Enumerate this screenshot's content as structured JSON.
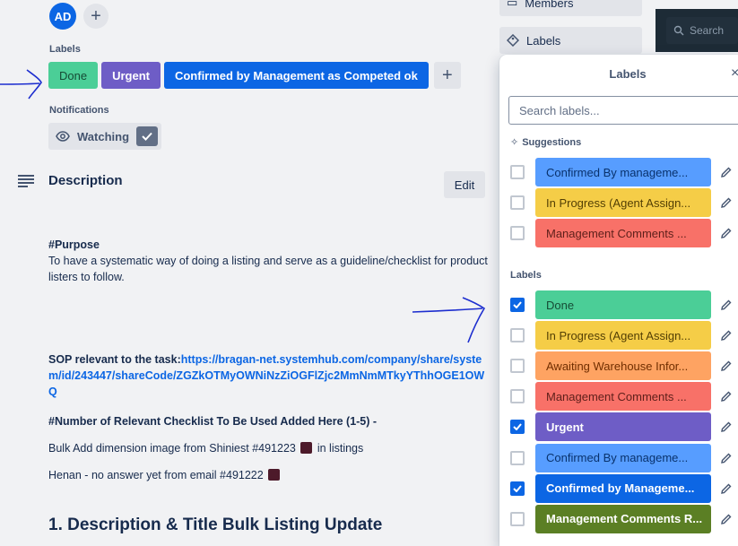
{
  "card": {
    "avatar_initials": "AD",
    "labels_heading": "Labels",
    "notifications_heading": "Notifications",
    "watching_label": "Watching",
    "applied_labels": [
      {
        "text": "Done",
        "color": "#4bce97"
      },
      {
        "text": "Urgent",
        "color": "#6e5dc6"
      },
      {
        "text": "Confirmed by Management as Competed ok",
        "color": "#0c66e4"
      }
    ],
    "description_title": "Description",
    "edit_label": "Edit",
    "purpose_heading": "#Purpose",
    "purpose_text": "To have a systematic way of doing a listing and serve as a guideline/checklist for product listers to follow.",
    "sop_label": "SOP relevant to the task:",
    "sop_link": "https://bragan-net.systemhub.com/company/share/system/id/243447/shareCode/ZGZkOTMyOWNiNzZiOGFlZjc2MmNmMTkyYThhOGE1OWQ",
    "checklist_heading": "#Number of Relevant Checklist To Be Used Added Here (1-5) -",
    "checklist_items": [
      {
        "text": "Bulk Add dimension image from Shiniest #491223",
        "suffix": "in listings"
      },
      {
        "text": "Henan - no answer yet from email #491222",
        "suffix": ""
      }
    ],
    "section_heading": "1. Description & Title Bulk Listing Update"
  },
  "sidebar": {
    "members_label": "Members",
    "labels_label": "Labels",
    "search_placeholder": "Search"
  },
  "popover": {
    "title": "Labels",
    "close_glyph": "×",
    "search_placeholder": "Search labels...",
    "suggestions_heading": "Suggestions",
    "labels_heading": "Labels",
    "suggestions": [
      {
        "text": "Confirmed By manageme...",
        "color": "#579dff",
        "text_color": "#09326c",
        "checked": false
      },
      {
        "text": "In Progress (Agent Assign...",
        "color": "#f5cd47",
        "text_color": "#533f04",
        "checked": false
      },
      {
        "text": "Management Comments ...",
        "color": "#f87168",
        "text_color": "#5d1f1a",
        "checked": false
      }
    ],
    "labels": [
      {
        "text": "Done",
        "color": "#4bce97",
        "text_color": "#164b35",
        "checked": true
      },
      {
        "text": "In Progress (Agent Assign...",
        "color": "#f5cd47",
        "text_color": "#533f04",
        "checked": false
      },
      {
        "text": "Awaiting Warehouse Infor...",
        "color": "#fea362",
        "text_color": "#702e00",
        "checked": false
      },
      {
        "text": "Management Comments ...",
        "color": "#f87168",
        "text_color": "#5d1f1a",
        "checked": false
      },
      {
        "text": "Urgent",
        "color": "#6e5dc6",
        "text_color": "#ffffff",
        "checked": true
      },
      {
        "text": "Confirmed By manageme...",
        "color": "#579dff",
        "text_color": "#09326c",
        "checked": false
      },
      {
        "text": "Confirmed by Manageme...",
        "color": "#0c66e4",
        "text_color": "#ffffff",
        "checked": true
      },
      {
        "text": "Management Comments R...",
        "color": "#5b7f24",
        "text_color": "#ffffff",
        "checked": false
      }
    ]
  },
  "colors": {
    "accent": "#0c66e4",
    "annotation_arrow": "#1d2ecf"
  }
}
